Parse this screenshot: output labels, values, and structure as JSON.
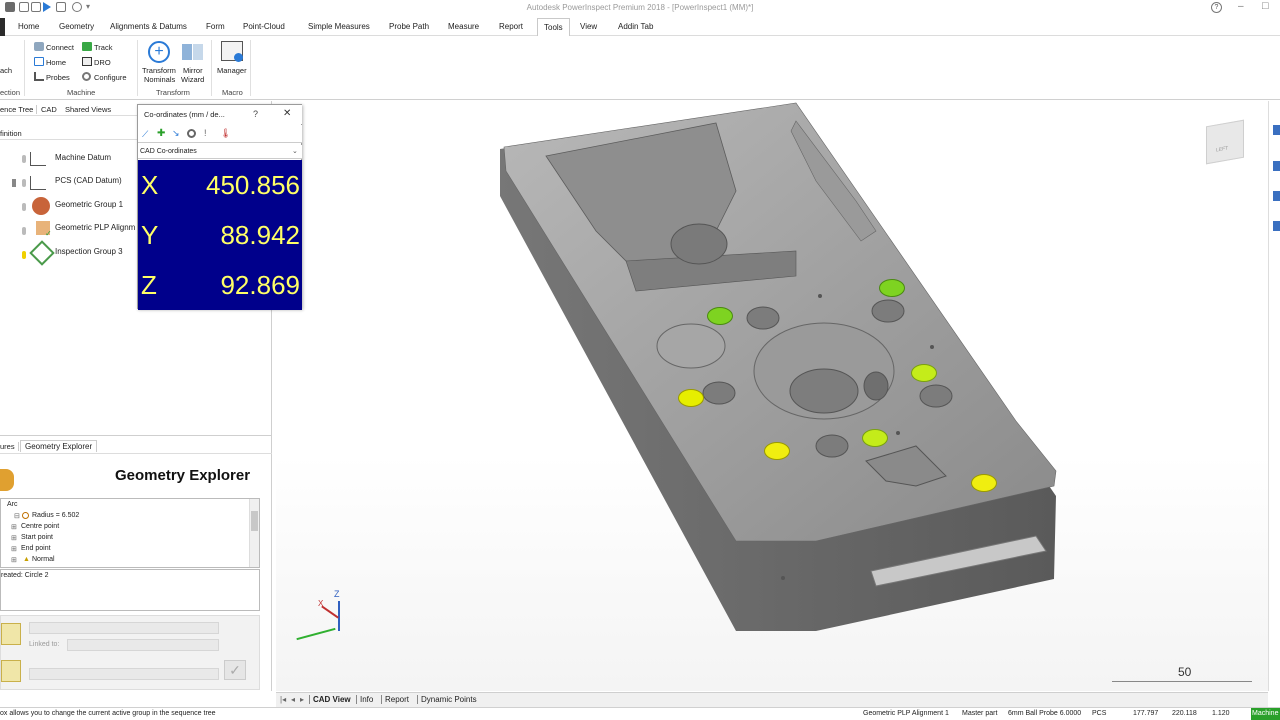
{
  "window": {
    "title": "Autodesk PowerInspect Premium 2018 - [PowerInspect1 (MM)*]"
  },
  "tabs": [
    "Home",
    "Geometry",
    "Alignments & Datums",
    "Form",
    "Point-Cloud",
    "Simple Measures",
    "Probe Path",
    "Measure",
    "Report",
    "Tools",
    "View",
    "Addin Tab"
  ],
  "active_tab": "Tools",
  "ribbon": {
    "left_cut_label": "ach",
    "machine_group": {
      "connect": "Connect",
      "track": "Track",
      "home": "Home",
      "dro": "DRO",
      "probes": "Probes",
      "configure": "Configure",
      "title": "Machine"
    },
    "cut_group_title": "ection",
    "transform_group": {
      "transform_nominals_1": "Transform",
      "transform_nominals_2": "Nominals",
      "mirror_wizard_1": "Mirror",
      "mirror_wizard_2": "Wizard",
      "title": "Transform"
    },
    "macro_group": {
      "manager": "Manager",
      "title": "Macro"
    }
  },
  "left_panel": {
    "tabs": [
      "ence Tree",
      "CAD",
      "Shared Views"
    ],
    "header": "finition",
    "tree": [
      "Machine Datum",
      "PCS (CAD Datum)",
      "Geometric Group 1",
      "Geometric PLP Alignm",
      "Inspection Group 3"
    ],
    "lower_tabs": [
      "ures",
      "Geometry Explorer"
    ],
    "explorer_title": "Geometry Explorer",
    "explorer_tree": [
      "Arc",
      "Radius = 6.502",
      "Centre point",
      "Start point",
      "End point",
      "Normal"
    ],
    "created": "reated: Circle 2",
    "linked_to": "Linked to:"
  },
  "coords_window": {
    "title": "Co-ordinates (mm / de...",
    "help": "?",
    "close": "✕",
    "system": "CAD Co-ordinates",
    "rows": [
      {
        "axis": "X",
        "value": "450.856"
      },
      {
        "axis": "Y",
        "value": "88.942"
      },
      {
        "axis": "Z",
        "value": "92.869"
      }
    ]
  },
  "viewport": {
    "scale_label": "50",
    "cube_label": "LEFT"
  },
  "bottom_tabs": [
    "CAD View",
    "Info",
    "Report",
    "Dynamic Points"
  ],
  "status": {
    "hint": "ox allows you to change the current active group in the sequence tree",
    "group": "Geometric PLP Alignment 1",
    "part": "Master part",
    "probe": "6mm Ball Probe 6.0000",
    "pcs": "PCS",
    "x": "177.797",
    "y": "220.118",
    "z": "1.120",
    "machine": "Machine"
  },
  "colors": {
    "coord_bg": "#00008b",
    "coord_text": "#ffff66",
    "green_dot": "#7ed321",
    "yellow_dot": "#e6e600",
    "accent": "#2a7ad6"
  }
}
